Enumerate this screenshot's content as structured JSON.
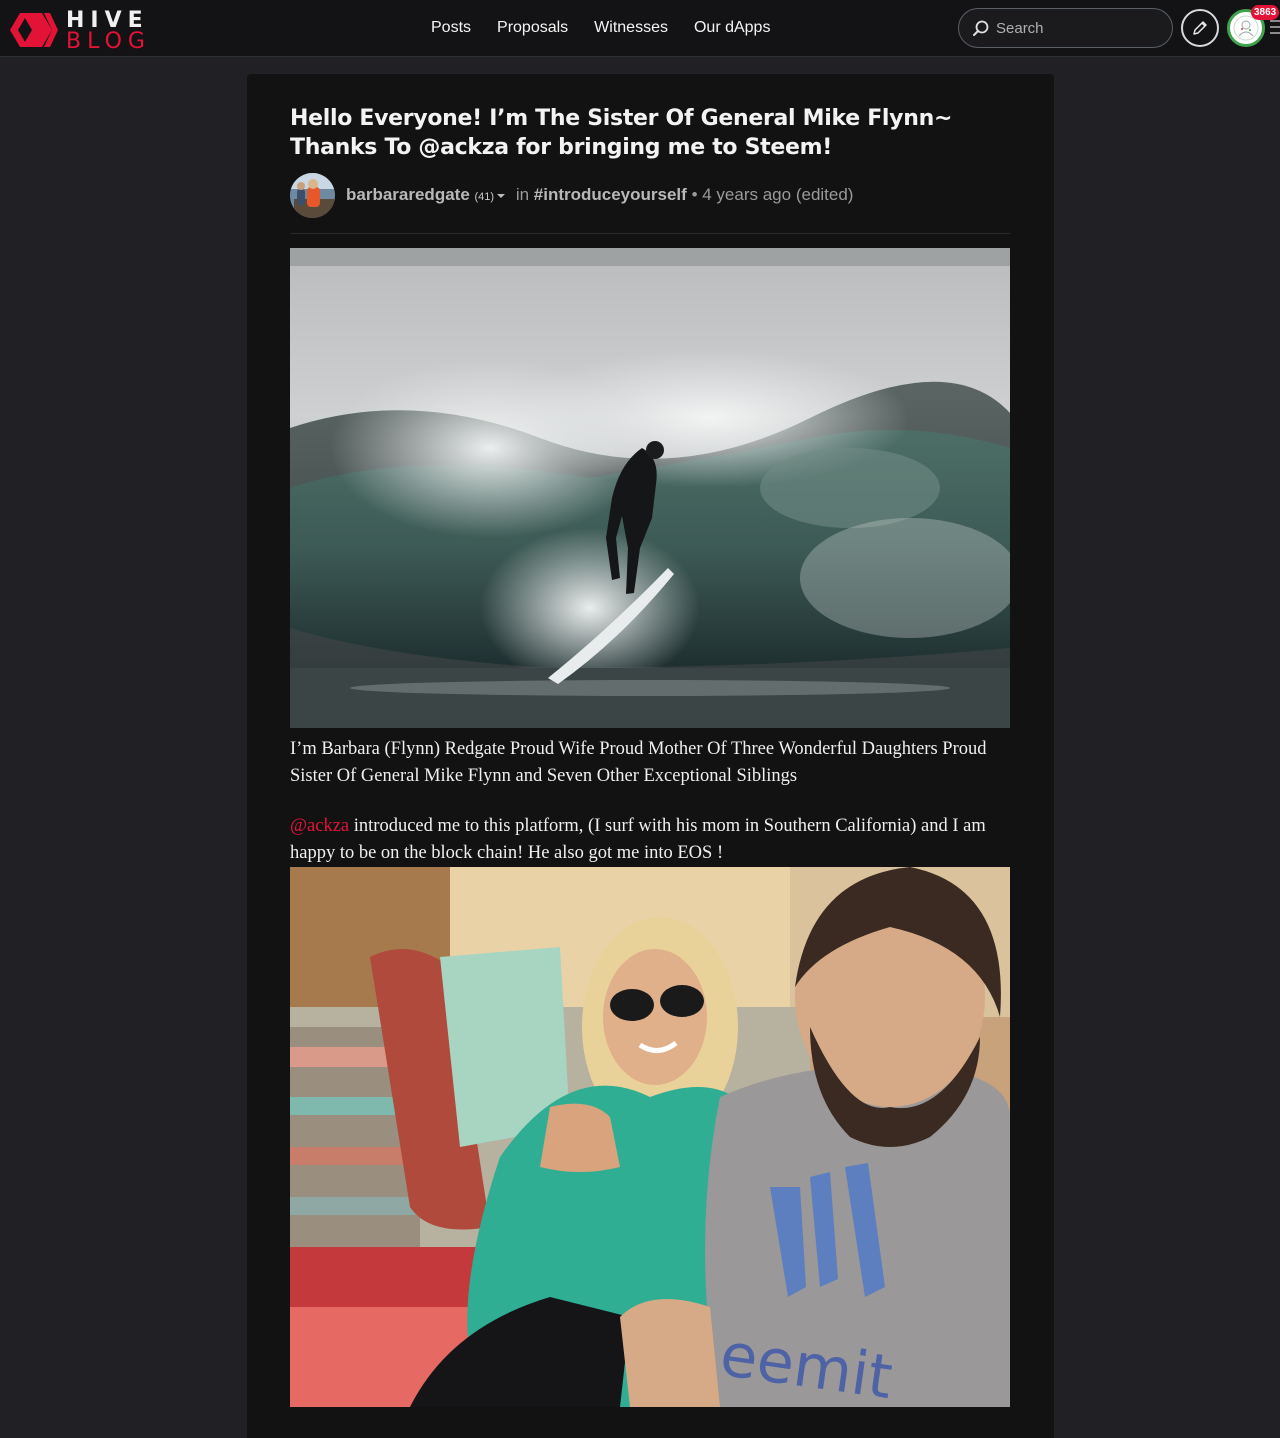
{
  "header": {
    "logo_top": "HIVE",
    "logo_bottom": "BLOG",
    "nav": [
      "Posts",
      "Proposals",
      "Witnesses",
      "Our dApps"
    ],
    "search_placeholder": "Search",
    "notification_count": "3863",
    "brand_color": "#e31337"
  },
  "post": {
    "title": "Hello Everyone! I’m The Sister Of General Mike Flynn~ Thanks To @ackza for bringing me to Steem!",
    "author": "barbararedgate",
    "reputation": "(41)",
    "in_label": "in",
    "category": "#introduceyourself",
    "separator": "•",
    "time": "4 years ago",
    "edited": "(edited)",
    "paragraph1": "I’m Barbara (Flynn) Redgate Proud Wife Proud Mother Of Three Wonderful Daughters Proud Sister Of General Mike Flynn and Seven Other Exceptional Siblings",
    "mention": "@ackza",
    "paragraph2_rest": " introduced me to this platform, (I surf with his mom in Southern California) and I am happy to be on the block chain! He also got me into EOS !"
  },
  "icons": {
    "logo": "hive-logo-icon",
    "search": "search-icon",
    "compose": "pencil-icon",
    "user": "user-avatar-icon"
  }
}
